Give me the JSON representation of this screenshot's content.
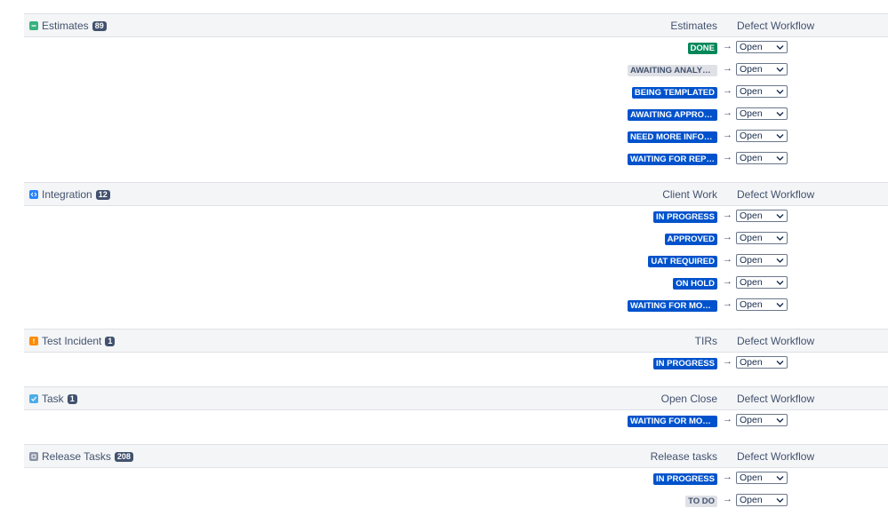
{
  "groups": [
    {
      "name": "Estimates",
      "count": "89",
      "icon": "subtract-square-icon",
      "icon_color": "#36b37e",
      "source_label": "Estimates",
      "target_label": "Defect Workflow",
      "rows": [
        {
          "status": "DONE",
          "status_bg": "#00875a",
          "status_fg": "#ffffff",
          "select_value": "Open"
        },
        {
          "status": "AWAITING ANALYSIS",
          "status_bg": "#dfe1e6",
          "status_fg": "#42526e",
          "select_value": "Open"
        },
        {
          "status": "BEING TEMPLATED",
          "status_bg": "#0052cc",
          "status_fg": "#ffffff",
          "select_value": "Open"
        },
        {
          "status": "AWAITING APPROVAL",
          "status_bg": "#0052cc",
          "status_fg": "#ffffff",
          "select_value": "Open"
        },
        {
          "status": "NEED MORE INFORM...",
          "status_bg": "#0052cc",
          "status_fg": "#ffffff",
          "select_value": "Open"
        },
        {
          "status": "WAITING FOR REPLY",
          "status_bg": "#0052cc",
          "status_fg": "#ffffff",
          "select_value": "Open"
        }
      ]
    },
    {
      "name": "Integration",
      "count": "12",
      "icon": "code-icon",
      "icon_color": "#2684ff",
      "source_label": "Client Work",
      "target_label": "Defect Workflow",
      "rows": [
        {
          "status": "IN PROGRESS",
          "status_bg": "#0052cc",
          "status_fg": "#ffffff",
          "select_value": "Open"
        },
        {
          "status": "APPROVED",
          "status_bg": "#0052cc",
          "status_fg": "#ffffff",
          "select_value": "Open"
        },
        {
          "status": "UAT REQUIRED",
          "status_bg": "#0052cc",
          "status_fg": "#ffffff",
          "select_value": "Open"
        },
        {
          "status": "ON HOLD",
          "status_bg": "#0052cc",
          "status_fg": "#ffffff",
          "select_value": "Open"
        },
        {
          "status": "WAITING FOR MORE C...",
          "status_bg": "#0052cc",
          "status_fg": "#ffffff",
          "select_value": "Open"
        }
      ]
    },
    {
      "name": "Test Incident",
      "count": "1",
      "icon": "exclamation-icon",
      "icon_color": "#ff8b00",
      "source_label": "TIRs",
      "target_label": "Defect Workflow",
      "rows": [
        {
          "status": "IN PROGRESS",
          "status_bg": "#0052cc",
          "status_fg": "#ffffff",
          "select_value": "Open"
        }
      ]
    },
    {
      "name": "Task",
      "count": "1",
      "icon": "checkbox-icon",
      "icon_color": "#4bade8",
      "source_label": "Open Close",
      "target_label": "Defect Workflow",
      "rows": [
        {
          "status": "WAITING FOR MORE C...",
          "status_bg": "#0052cc",
          "status_fg": "#ffffff",
          "select_value": "Open"
        }
      ]
    },
    {
      "name": "Release Tasks",
      "count": "208",
      "icon": "release-icon",
      "icon_color": "#8993a4",
      "source_label": "Release tasks",
      "target_label": "Defect Workflow",
      "rows": [
        {
          "status": "IN PROGRESS",
          "status_bg": "#0052cc",
          "status_fg": "#ffffff",
          "select_value": "Open"
        },
        {
          "status": "TO DO",
          "status_bg": "#dfe1e6",
          "status_fg": "#42526e",
          "select_value": "Open"
        }
      ]
    }
  ],
  "arrow_glyph": "→"
}
